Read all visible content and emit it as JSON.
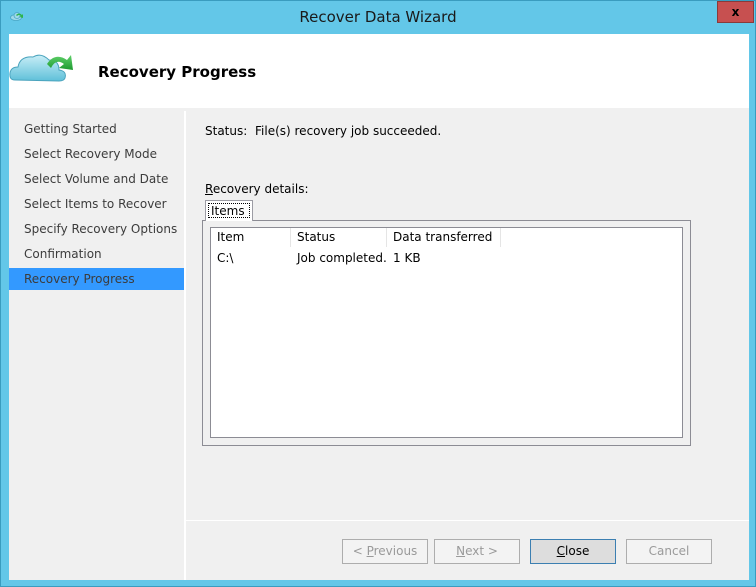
{
  "window": {
    "title": "Recover Data Wizard",
    "close_glyph": "x",
    "icon": "cloud-recover-icon"
  },
  "header": {
    "title": "Recovery Progress",
    "icon": "cloud-recover-icon"
  },
  "nav": {
    "items": [
      {
        "label": "Getting Started",
        "active": false
      },
      {
        "label": "Select Recovery Mode",
        "active": false
      },
      {
        "label": "Select Volume and Date",
        "active": false
      },
      {
        "label": "Select Items to Recover",
        "active": false
      },
      {
        "label": "Specify Recovery Options",
        "active": false
      },
      {
        "label": "Confirmation",
        "active": false
      },
      {
        "label": "Recovery Progress",
        "active": true
      }
    ]
  },
  "main": {
    "status_label": "Status:",
    "status_value": "File(s) recovery job succeeded.",
    "details_label_accel": "R",
    "details_label_rest": "ecovery details:",
    "tabs": [
      {
        "label": "Items",
        "selected": true
      }
    ],
    "table": {
      "columns": [
        "Item",
        "Status",
        "Data transferred"
      ],
      "rows": [
        [
          "C:\\",
          "Job completed.",
          "1 KB"
        ]
      ]
    }
  },
  "buttons": {
    "previous": {
      "prefix": "< ",
      "accel": "P",
      "rest": "revious",
      "enabled": false
    },
    "next": {
      "accel": "N",
      "rest": "ext >",
      "enabled": false
    },
    "close": {
      "accel": "C",
      "rest": "lose",
      "enabled": true
    },
    "cancel": {
      "label": "Cancel",
      "enabled": false
    }
  },
  "colors": {
    "titlebar": "#63c7e8",
    "close_button": "#c75050",
    "nav_selected": "#3399ff"
  }
}
